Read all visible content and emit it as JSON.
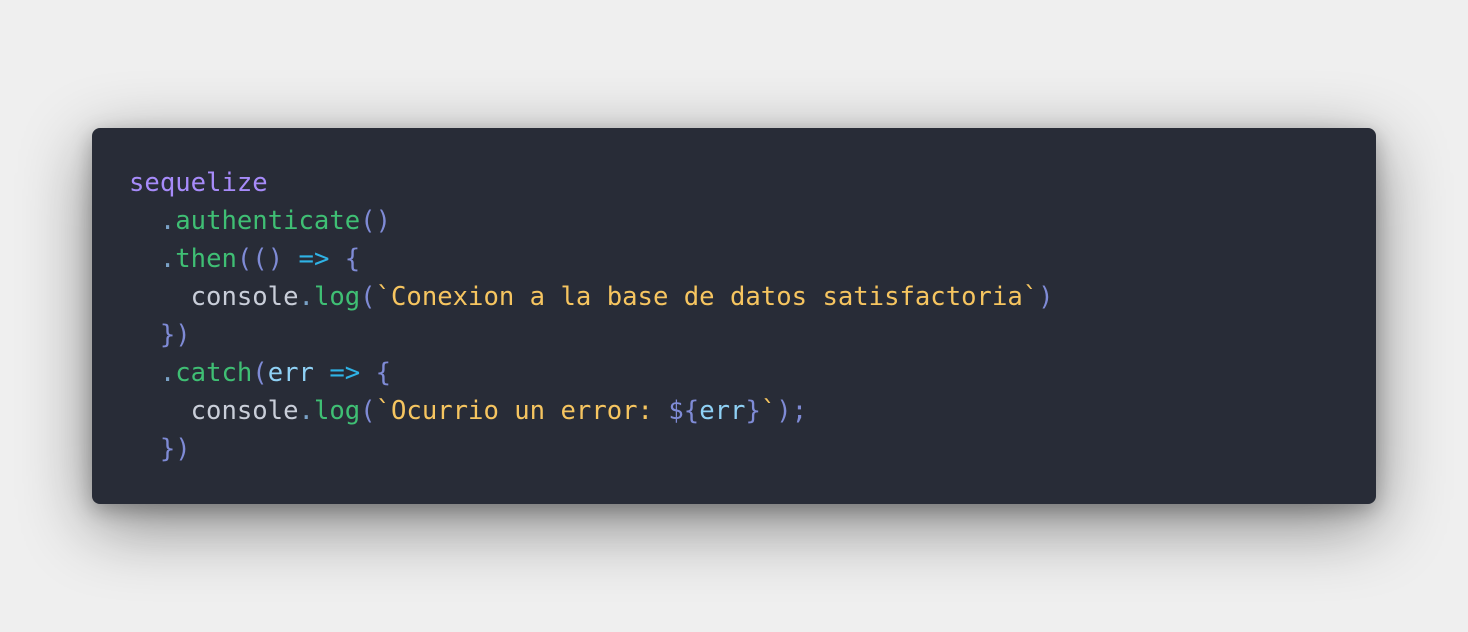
{
  "theme": {
    "background": "#efefef",
    "editor_background": "#282c37"
  },
  "code": {
    "language": "javascript",
    "lines": [
      [
        {
          "text": "sequelize",
          "color": "#a78bfa"
        }
      ],
      [
        {
          "text": "  ",
          "color": "#bfc7d5"
        },
        {
          "text": ".",
          "color": "#7aa2c7"
        },
        {
          "text": "authenticate",
          "color": "#3fbf74"
        },
        {
          "text": "()",
          "color": "#7f8bd6"
        }
      ],
      [
        {
          "text": "  ",
          "color": "#bfc7d5"
        },
        {
          "text": ".",
          "color": "#7aa2c7"
        },
        {
          "text": "then",
          "color": "#3fbf74"
        },
        {
          "text": "(()",
          "color": "#7f8bd6"
        },
        {
          "text": " ",
          "color": "#bfc7d5"
        },
        {
          "text": "=>",
          "color": "#2fb3e6"
        },
        {
          "text": " ",
          "color": "#bfc7d5"
        },
        {
          "text": "{",
          "color": "#7f8bd6"
        }
      ],
      [
        {
          "text": "    ",
          "color": "#bfc7d5"
        },
        {
          "text": "console",
          "color": "#c9ced9"
        },
        {
          "text": ".",
          "color": "#7aa2c7"
        },
        {
          "text": "log",
          "color": "#3fbf74"
        },
        {
          "text": "(",
          "color": "#7f8bd6"
        },
        {
          "text": "`Conexion a la base de datos satisfactoria`",
          "color": "#f6c560"
        },
        {
          "text": ")",
          "color": "#7f8bd6"
        }
      ],
      [
        {
          "text": "  ",
          "color": "#bfc7d5"
        },
        {
          "text": "})",
          "color": "#7f8bd6"
        }
      ],
      [
        {
          "text": "  ",
          "color": "#bfc7d5"
        },
        {
          "text": ".",
          "color": "#7aa2c7"
        },
        {
          "text": "catch",
          "color": "#3fbf74"
        },
        {
          "text": "(",
          "color": "#7f8bd6"
        },
        {
          "text": "err",
          "color": "#8fd1f5"
        },
        {
          "text": " ",
          "color": "#bfc7d5"
        },
        {
          "text": "=>",
          "color": "#2fb3e6"
        },
        {
          "text": " ",
          "color": "#bfc7d5"
        },
        {
          "text": "{",
          "color": "#7f8bd6"
        }
      ],
      [
        {
          "text": "    ",
          "color": "#bfc7d5"
        },
        {
          "text": "console",
          "color": "#c9ced9"
        },
        {
          "text": ".",
          "color": "#7aa2c7"
        },
        {
          "text": "log",
          "color": "#3fbf74"
        },
        {
          "text": "(",
          "color": "#7f8bd6"
        },
        {
          "text": "`Ocurrio un error: ",
          "color": "#f6c560"
        },
        {
          "text": "${",
          "color": "#7f8bd6"
        },
        {
          "text": "err",
          "color": "#8fd1f5"
        },
        {
          "text": "}",
          "color": "#7f8bd6"
        },
        {
          "text": "`",
          "color": "#f6c560"
        },
        {
          "text": ");",
          "color": "#7f8bd6"
        }
      ],
      [
        {
          "text": "  ",
          "color": "#bfc7d5"
        },
        {
          "text": "})",
          "color": "#7f8bd6"
        }
      ]
    ]
  }
}
